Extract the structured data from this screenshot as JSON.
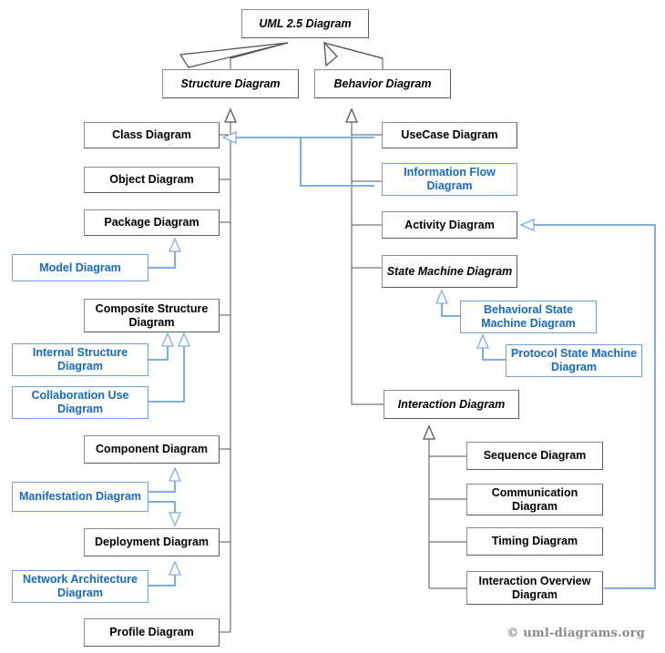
{
  "diagram": {
    "title": "UML 2.5 Diagram",
    "credit": "© uml-diagrams.org",
    "colors": {
      "black_box_border": "#7a7a7a",
      "black_box_text": "#000000",
      "blue_box_border": "#6fa3da",
      "blue_box_text": "#1569C7",
      "blue_line": "#7FAEE0",
      "black_line": "#555555",
      "credit_text": "#8a8a8a",
      "background": "#ffffff"
    },
    "nodes": {
      "root": {
        "label": "UML 2.5 Diagram",
        "kind": "abstract",
        "style": "black-italic"
      },
      "structure": {
        "label": "Structure Diagram",
        "kind": "abstract",
        "style": "black-italic"
      },
      "behavior": {
        "label": "Behavior Diagram",
        "kind": "abstract",
        "style": "black-italic"
      },
      "class": {
        "label": "Class Diagram",
        "kind": "concrete",
        "style": "black"
      },
      "object": {
        "label": "Object Diagram",
        "kind": "concrete",
        "style": "black"
      },
      "package": {
        "label": "Package Diagram",
        "kind": "concrete",
        "style": "black"
      },
      "model": {
        "label": "Model Diagram",
        "kind": "extension",
        "style": "blue"
      },
      "composite_structure": {
        "label": "Composite Structure Diagram",
        "kind": "concrete",
        "style": "black"
      },
      "internal_structure": {
        "label": "Internal Structure Diagram",
        "kind": "extension",
        "style": "blue"
      },
      "collaboration_use": {
        "label": "Collaboration Use Diagram",
        "kind": "extension",
        "style": "blue"
      },
      "component": {
        "label": "Component Diagram",
        "kind": "concrete",
        "style": "black"
      },
      "manifestation": {
        "label": "Manifestation Diagram",
        "kind": "extension",
        "style": "blue"
      },
      "deployment": {
        "label": "Deployment Diagram",
        "kind": "concrete",
        "style": "black"
      },
      "network_architecture": {
        "label": "Network Architecture Diagram",
        "kind": "extension",
        "style": "blue"
      },
      "profile": {
        "label": "Profile Diagram",
        "kind": "concrete",
        "style": "black"
      },
      "usecase": {
        "label": "UseCase Diagram",
        "kind": "concrete",
        "style": "black"
      },
      "information_flow": {
        "label": "Information Flow Diagram",
        "kind": "extension",
        "style": "blue"
      },
      "activity": {
        "label": "Activity Diagram",
        "kind": "concrete",
        "style": "black"
      },
      "state_machine": {
        "label": "State Machine Diagram",
        "kind": "abstract",
        "style": "black-italic"
      },
      "behavioral_state_machine": {
        "label": "Behavioral State Machine Diagram",
        "kind": "extension",
        "style": "blue"
      },
      "protocol_state_machine": {
        "label": "Protocol State Machine Diagram",
        "kind": "extension",
        "style": "blue"
      },
      "interaction": {
        "label": "Interaction Diagram",
        "kind": "abstract",
        "style": "black-italic"
      },
      "sequence": {
        "label": "Sequence Diagram",
        "kind": "concrete",
        "style": "black"
      },
      "communication": {
        "label": "Communication Diagram",
        "kind": "concrete",
        "style": "black"
      },
      "timing": {
        "label": "Timing Diagram",
        "kind": "concrete",
        "style": "black"
      },
      "interaction_overview": {
        "label": "Interaction Overview Diagram",
        "kind": "concrete",
        "style": "black"
      }
    },
    "generalizations": [
      {
        "child": "structure",
        "parent": "root",
        "color": "black"
      },
      {
        "child": "behavior",
        "parent": "root",
        "color": "black"
      },
      {
        "child": "class",
        "parent": "structure",
        "color": "black"
      },
      {
        "child": "object",
        "parent": "structure",
        "color": "black"
      },
      {
        "child": "package",
        "parent": "structure",
        "color": "black"
      },
      {
        "child": "composite_structure",
        "parent": "structure",
        "color": "black"
      },
      {
        "child": "component",
        "parent": "structure",
        "color": "black"
      },
      {
        "child": "deployment",
        "parent": "structure",
        "color": "black"
      },
      {
        "child": "profile",
        "parent": "structure",
        "color": "black"
      },
      {
        "child": "model",
        "parent": "package",
        "color": "blue"
      },
      {
        "child": "internal_structure",
        "parent": "composite_structure",
        "color": "blue"
      },
      {
        "child": "collaboration_use",
        "parent": "composite_structure",
        "color": "blue"
      },
      {
        "child": "manifestation",
        "parent": "component",
        "color": "blue"
      },
      {
        "child": "manifestation",
        "parent": "deployment",
        "color": "blue"
      },
      {
        "child": "network_architecture",
        "parent": "deployment",
        "color": "blue"
      },
      {
        "child": "usecase",
        "parent": "behavior",
        "color": "black"
      },
      {
        "child": "information_flow",
        "parent": "behavior",
        "color": "black"
      },
      {
        "child": "activity",
        "parent": "behavior",
        "color": "black"
      },
      {
        "child": "state_machine",
        "parent": "behavior",
        "color": "black"
      },
      {
        "child": "interaction",
        "parent": "behavior",
        "color": "black"
      },
      {
        "child": "behavioral_state_machine",
        "parent": "state_machine",
        "color": "blue"
      },
      {
        "child": "protocol_state_machine",
        "parent": "behavioral_state_machine",
        "color": "blue"
      },
      {
        "child": "sequence",
        "parent": "interaction",
        "color": "black"
      },
      {
        "child": "communication",
        "parent": "interaction",
        "color": "black"
      },
      {
        "child": "timing",
        "parent": "interaction",
        "color": "black"
      },
      {
        "child": "interaction_overview",
        "parent": "interaction",
        "color": "black"
      },
      {
        "child": "information_flow",
        "parent": "class",
        "color": "blue"
      },
      {
        "child": "usecase",
        "parent": "class",
        "color": "blue"
      },
      {
        "child": "interaction_overview",
        "parent": "activity",
        "color": "blue"
      }
    ]
  }
}
